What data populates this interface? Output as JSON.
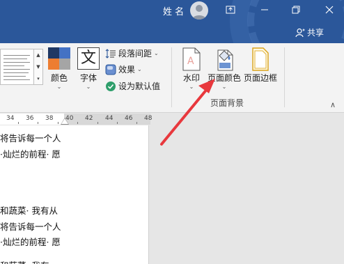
{
  "titlebar": {
    "user_name": "姓 名",
    "share_label": "共享",
    "controls": [
      "ribbon-display-icon",
      "minimize-icon",
      "restore-icon",
      "close-icon"
    ]
  },
  "ribbon": {
    "colors_label": "颜色",
    "fonts_label": "字体",
    "fonts_glyph": "文",
    "paragraph_spacing_label": "段落间距",
    "effects_label": "效果",
    "set_default_label": "设为默认值",
    "watermark_label": "水印",
    "page_color_label": "页面颜色",
    "page_borders_label": "页面边框",
    "page_background_group": "页面背景",
    "theme_swatches": [
      "#1f3864",
      "#4472c4",
      "#ed7d31",
      "#a5a5a5"
    ]
  },
  "ruler": {
    "labels": [
      "34",
      "36",
      "38",
      "40",
      "42",
      "44",
      "46",
      "48"
    ]
  },
  "document": {
    "lines": [
      "将告诉每一个人",
      "·灿烂的前程· 愿",
      "",
      "",
      "",
      "和蔬菜· 我有从",
      "将告诉每一个人",
      "·灿烂的前程· 愿",
      "",
      "和蔬菜· 我有"
    ]
  },
  "colors": {
    "titlebar": "#2b579a",
    "annotation_arrow": "#e8383d",
    "checkmark": "#2e9e6b"
  }
}
